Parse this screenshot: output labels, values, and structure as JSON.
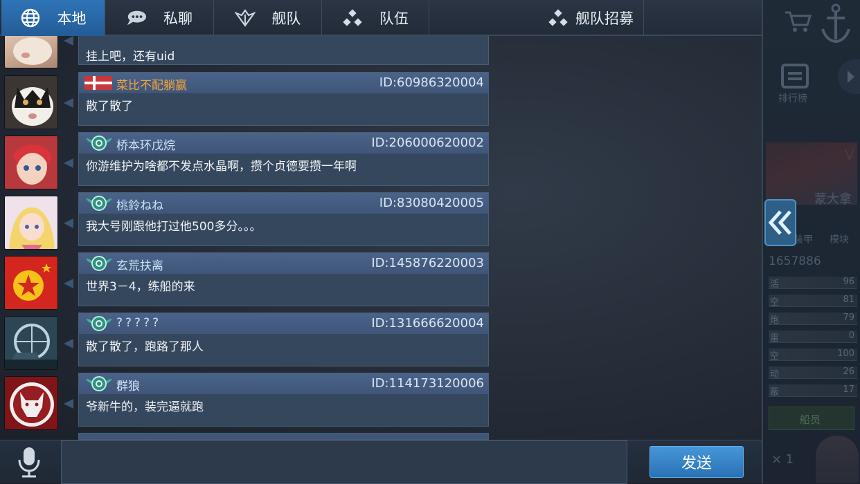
{
  "tabs": [
    {
      "label": "本地",
      "icon": "globe-icon",
      "active": true
    },
    {
      "label": "私聊",
      "icon": "chat-bubble-icon",
      "active": false
    },
    {
      "label": "舰队",
      "icon": "fleet-wing-icon",
      "active": false
    },
    {
      "label": "队伍",
      "icon": "team-dots-icon",
      "active": false
    },
    {
      "label": "舰队招募",
      "icon": "team-dots-icon",
      "active": false
    }
  ],
  "messages": [
    {
      "name": "",
      "uid": "",
      "text": "挂上吧，还有uid",
      "avatar": "cat-avatar",
      "badge": ""
    },
    {
      "name": "菜比不配躺赢",
      "uid": "ID:60986320004",
      "text": "散了散了",
      "avatar": "black-white-cat-avatar",
      "badge": "flag-badge",
      "name_color": "orange"
    },
    {
      "name": "桥本环戊烷",
      "uid": "ID:206000620002",
      "text": "你游维护为啥都不发点水晶啊，攒个贞德要攒一年啊",
      "avatar": "red-hair-girl-avatar",
      "badge": "wings-badge"
    },
    {
      "name": "桃鈴ねね",
      "uid": "ID:83080420005",
      "text": "我大号刚跟他打过他500多分。。。",
      "avatar": "blonde-girl-avatar",
      "badge": "wings-badge"
    },
    {
      "name": "玄荒扶离",
      "uid": "ID:145876220003",
      "text": "世界3－4，练船的来",
      "avatar": "star-emblem-avatar",
      "badge": "wings-badge"
    },
    {
      "name": "?????",
      "uid": "ID:131666620004",
      "text": "散了散了，跑路了那人",
      "avatar": "ship-target-avatar",
      "badge": "wings-badge"
    },
    {
      "name": "群狼",
      "uid": "ID:114173120006",
      "text": "爷新牛的，装完逼就跑",
      "avatar": "wolf-avatar",
      "badge": "wings-badge"
    }
  ],
  "input": {
    "placeholder": "",
    "value": ""
  },
  "send_label": "发送",
  "background_panel": {
    "rank_label": "排行榜",
    "ship_name": "蒙大拿",
    "tier": "V",
    "tab1": "装甲",
    "tab2": "模块",
    "power": "1657886",
    "stats": [
      {
        "k": "活",
        "v": "96"
      },
      {
        "k": "空",
        "v": "81"
      },
      {
        "k": "炮",
        "v": "79"
      },
      {
        "k": "雷",
        "v": "0"
      },
      {
        "k": "空",
        "v": "100"
      },
      {
        "k": "动",
        "v": "26"
      },
      {
        "k": "蔽",
        "v": "17"
      }
    ],
    "crew_label": "船员",
    "multiplier": "× 1"
  }
}
